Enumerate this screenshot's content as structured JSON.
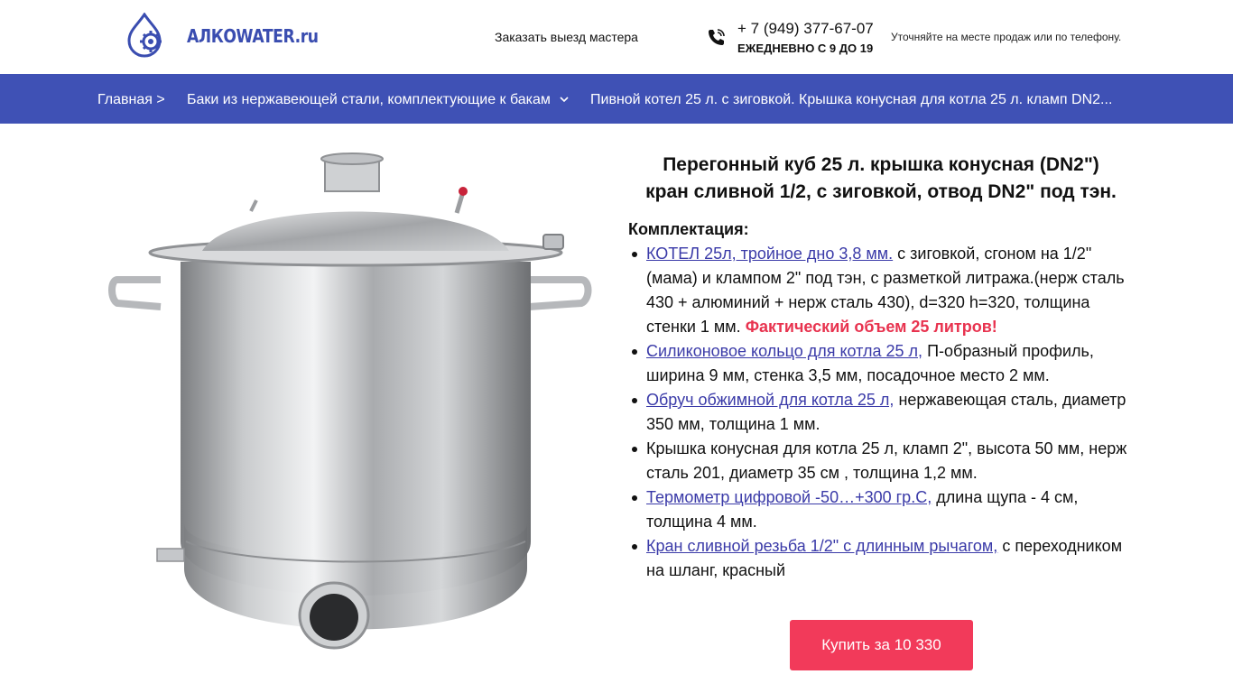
{
  "header": {
    "brand": "АЛКОWATER.ru",
    "order_link": "Заказать выезд мастера",
    "phone": "+ 7 (949) 377-67-07",
    "hours": "ЕЖЕДНЕВНО С 9 ДО 19",
    "note": "Уточняйте на месте продаж или по телефону.",
    "brand_color": "#3a4db0"
  },
  "breadcrumbs": {
    "home": "Главная >",
    "category": "Баки из нержавеющей стали, комплектующие к бакам",
    "current": "Пивной котел 25 л. с зиговкой. Крышка конусная для котла 25 л. кламп DN2...",
    "bar_color": "#3f51b5"
  },
  "product": {
    "title_line1": "Перегонный куб 25 л. крышка конусная (DN2\")",
    "title_line2": "кран сливной 1/2, с зиговкой, отвод DN2\" под тэн.",
    "kit_heading": "Комплектация:",
    "items": [
      {
        "link": "КОТЕЛ 25л, тройное дно 3,8 мм.",
        "text": " с зиговкой, сгоном на 1/2\" (мама) и клампом 2\" под тэн, с разметкой литража.(нерж сталь 430 + алюминий + нерж сталь 430), d=320 h=320, толщина стенки 1 мм. ",
        "highlight": "Фактический объем 25 литров!"
      },
      {
        "link": "Силиконовое кольцо для котла 25 л,",
        "text": " П-образный профиль, ширина 9 мм, стенка 3,5 мм, посадочное место 2 мм."
      },
      {
        "link": "Обруч обжимной для котла 25 л,",
        "text": " нержавеющая сталь, диаметр 350 мм, толщина 1 мм."
      },
      {
        "text": "Крышка конусная для котла 25 л, кламп 2\", высота 50 мм, нерж сталь 201, диаметр 35 см , толщина 1,2 мм."
      },
      {
        "link": "Термометр цифровой -50…+300 гр.С,",
        "text": " длина щупа - 4 см, толщина 4 мм."
      },
      {
        "link": "Кран сливной резьба 1/2\" с длинным рычагом,",
        "text": " с переходником на шланг, красный"
      }
    ],
    "buy_label": "Купить за 10 330 ",
    "buy_icon": "",
    "buy_color": "#f23a5a",
    "highlight_color": "#e8334f"
  }
}
